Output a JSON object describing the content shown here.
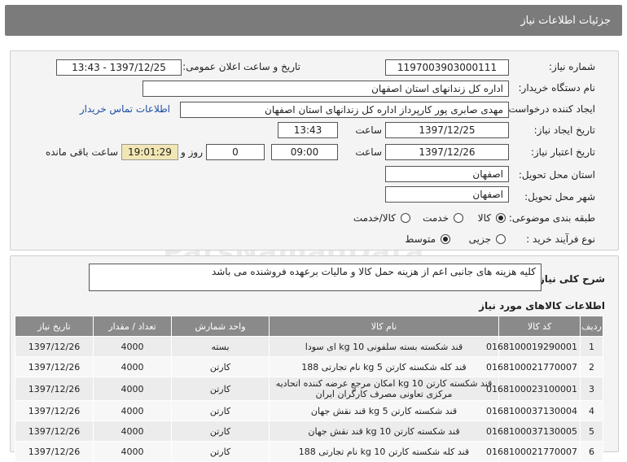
{
  "header": {
    "title": "جزئیات اطلاعات نیاز"
  },
  "form": {
    "need_number_label": "شماره نیاز:",
    "need_number": "1197003903000111",
    "announce_label": "تاریخ و ساعت اعلان عمومی:",
    "announce_value": "1397/12/25 - 13:43",
    "buyer_org_label": "نام دستگاه خریدار:",
    "buyer_org": "اداره کل زندانهای استان اصفهان",
    "requester_label": "ایجاد کننده درخواست:",
    "requester": "مهدی صابری پور کارپرداز اداره کل زندانهای استان اصفهان",
    "contact_link": "اطلاعات تماس خریدار",
    "created_label": "تاریخ ایجاد نیاز:",
    "created_date": "1397/12/25",
    "time_label": "ساعت",
    "created_time": "13:43",
    "valid_label": "تاریخ اعتبار نیاز:",
    "valid_date": "1397/12/26",
    "valid_time": "09:00",
    "days_value": "0",
    "days_label": "روز و",
    "remaining_time": "19:01:29",
    "remaining_label": "ساعت باقی مانده",
    "province_label": "استان محل تحویل:",
    "province": "اصفهان",
    "city_label": "شهر محل تحویل:",
    "city": "اصفهان",
    "category_label": "طبقه بندی موضوعی:",
    "category_options": [
      "کالا",
      "خدمت",
      "کالا/خدمت"
    ],
    "category_selected": "کالا",
    "process_label": "نوع فرآیند خرید :",
    "process_options": [
      "جزیی",
      "متوسط"
    ],
    "process_selected": "متوسط"
  },
  "description": {
    "label": "شرح کلی نیاز:",
    "text": "کلیه هزینه های جانبی اعم از هزینه حمل کالا و مالیات برعهده فروشنده می باشد"
  },
  "items_section": {
    "title": "اطلاعات کالاهای مورد نیاز",
    "columns": [
      "ردیف",
      "کد کالا",
      "نام کالا",
      "واحد شمارش",
      "تعداد / مقدار",
      "تاریخ نیاز"
    ],
    "rows": [
      [
        "1",
        "0168100019290001",
        "قند شکسته بسته سلفونی kg 10 ای سودا",
        "بسته",
        "4000",
        "1397/12/26"
      ],
      [
        "2",
        "0168100021770007",
        "قند کله شکسته کارتن kg 5 نام تجارتی 188",
        "کارتن",
        "4000",
        "1397/12/26"
      ],
      [
        "3",
        "0168100023100001",
        "قند شکسته کارتن kg 10 امکان مرجع عرضه کننده اتحادیه مرکزی تعاونی مصرف کارگران ایران",
        "کارتن",
        "4000",
        "1397/12/26"
      ],
      [
        "4",
        "0168100037130004",
        "قند شکسته کارتن kg 5 قند نقش جهان",
        "کارتن",
        "4000",
        "1397/12/26"
      ],
      [
        "5",
        "0168100037130005",
        "قند شکسته کارتن kg 10 قند نقش جهان",
        "کارتن",
        "4000",
        "1397/12/26"
      ],
      [
        "6",
        "0168100021770007",
        "قند کله شکسته کارتن kg 10 نام تجارتی 188",
        "کارتن",
        "4000",
        "1397/12/26"
      ]
    ]
  },
  "watermark": "ParsNamadData"
}
